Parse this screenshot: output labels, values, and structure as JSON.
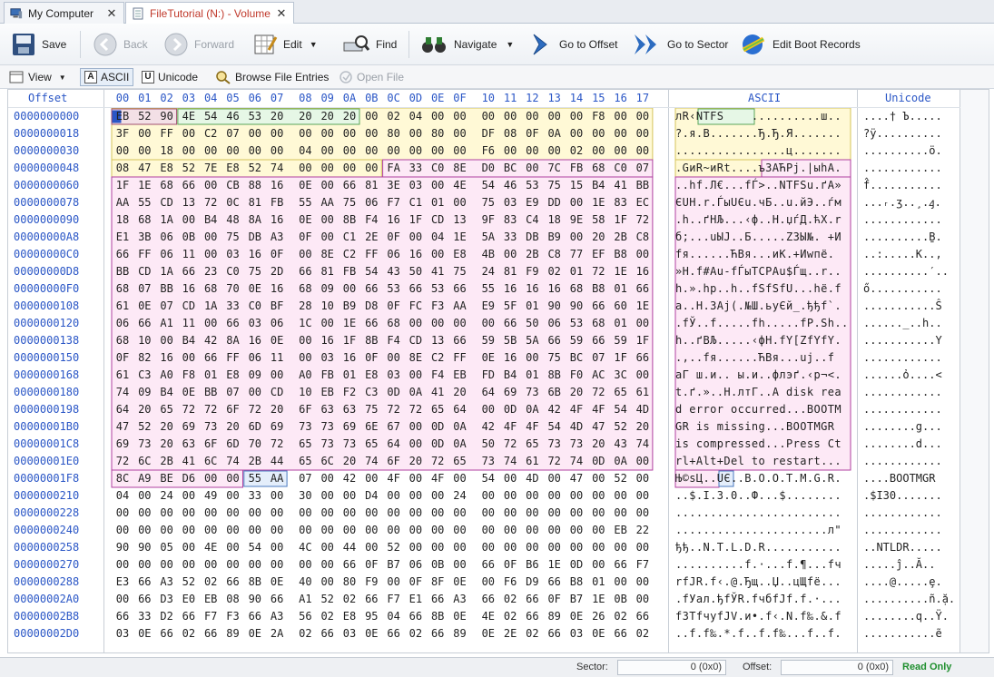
{
  "tabs": [
    {
      "label": "My Computer",
      "close": "✕",
      "icon": "computer-icon"
    },
    {
      "label": "FileTutorial (N:) - Volume",
      "close": "✕",
      "icon": "volume-icon"
    }
  ],
  "toolbar": {
    "save": "Save",
    "back": "Back",
    "forward": "Forward",
    "edit": "Edit",
    "find": "Find",
    "navigate": "Navigate",
    "goto_offset": "Go to Offset",
    "goto_sector": "Go to Sector",
    "edit_boot": "Edit Boot Records"
  },
  "toolbar2": {
    "view": "View",
    "ascii": "ASCII",
    "unicode": "Unicode",
    "browse": "Browse File Entries",
    "open": "Open File"
  },
  "headers": {
    "offset": "Offset",
    "bytes": [
      "00",
      "01",
      "02",
      "03",
      "04",
      "05",
      "06",
      "07",
      "08",
      "09",
      "0A",
      "0B",
      "0C",
      "0D",
      "0E",
      "0F",
      "10",
      "11",
      "12",
      "13",
      "14",
      "15",
      "16",
      "17"
    ],
    "ascii": "ASCII",
    "unicode": "Unicode"
  },
  "rows": [
    {
      "off": "0000000000",
      "hex": "EB 52 90 4E 54 46 53 20 20 20 20 00 02 04 00 00 00 00 00 00 00 F8 00 00",
      "asc": "лR‹NTFS    ..........ш..",
      "uni": "....† Ъ....."
    },
    {
      "off": "0000000018",
      "hex": "3F 00 FF 00 C2 07 00 00 00 00 00 00 80 00 80 00 DF 08 0F 0A 00 00 00 00",
      "asc": "?.я.В.......Ђ.Ђ.Я.......",
      "uni": "?ÿ.........."
    },
    {
      "off": "0000000030",
      "hex": "00 00 18 00 00 00 00 00 04 00 00 00 00 00 00 00 F6 00 00 00 02 00 00 00",
      "asc": "................ц.......",
      "uni": "..........ö."
    },
    {
      "off": "0000000048",
      "hex": "08 47 E8 52 7E E8 52 74 00 00 00 00 FA 33 C0 8E D0 BC 00 7C FB 68 C0 07",
      "asc": ".GиR~иRt....ъ3АЋРј.|ыhА.",
      "uni": "............"
    },
    {
      "off": "0000000060",
      "hex": "1F 1E 68 66 00 CB 88 16 0E 00 66 81 3E 03 00 4E 54 46 53 75 15 B4 41 BB",
      "asc": "..hf.Л€...fЃ>..NTFSu.ґA»",
      "uni": "f̂..........."
    },
    {
      "off": "0000000078",
      "hex": "AA 55 CD 13 72 0C 81 FB 55 AA 75 06 F7 C1 01 00 75 03 E9 DD 00 1E 83 EC",
      "asc": "ЄUН.r.ЃыUЄu.чБ..u.йЭ..ѓм",
      "uni": "...ᵣ.ʒ..¸.ꜭ."
    },
    {
      "off": "0000000090",
      "hex": "18 68 1A 00 B4 48 8A 16 0E 00 8B F4 16 1F CD 13 9F 83 C4 18 9E 58 1F 72",
      "asc": ".h..ґHЉ...‹ф..Н.џѓД.ћX.r",
      "uni": "............"
    },
    {
      "off": "00000000A8",
      "hex": "E1 3B 06 0B 00 75 DB A3 0F 00 C1 2E 0F 00 04 1E 5A 33 DB B9 00 20 2B C8",
      "asc": "б;...uЫЈ..Б.....Z3Ы№. +И",
      "uni": "..........Ḇ."
    },
    {
      "off": "00000000C0",
      "hex": "66 FF 06 11 00 03 16 0F 00 8E C2 FF 06 16 00 E8 4B 00 2B C8 77 EF B8 00",
      "asc": "fя......ЋВя...иK.+Иwпё.",
      "uni": "..:.....K..,"
    },
    {
      "off": "00000000D8",
      "hex": "BB CD 1A 66 23 C0 75 2D 66 81 FB 54 43 50 41 75 24 81 F9 02 01 72 1E 16",
      "asc": "»Н.f#Аu-fЃыTCPAu$Ѓщ..r..",
      "uni": "..........′.."
    },
    {
      "off": "00000000F0",
      "hex": "68 07 BB 16 68 70 0E 16 68 09 00 66 53 66 53 66 55 16 16 16 68 B8 01 66",
      "asc": "h.».hp..h..fSfSfU...hё.f",
      "uni": "ő..........."
    },
    {
      "off": "0000000108",
      "hex": "61 0E 07 CD 1A 33 C0 BF 28 10 B9 D8 0F FC F3 AA E9 5F 01 90 90 66 60 1E",
      "asc": "a..Н.3Ај(.№Ш.ьуЄй_.ђђf`.",
      "uni": "...........Ŝ"
    },
    {
      "off": "0000000120",
      "hex": "06 66 A1 11 00 66 03 06 1C 00 1E 66 68 00 00 00 00 66 50 06 53 68 01 00",
      "asc": ".fЎ..f.....fh.....fP.Sh..",
      "uni": "......_..h.."
    },
    {
      "off": "0000000138",
      "hex": "68 10 00 B4 42 8A 16 0E 00 16 1F 8B F4 CD 13 66 59 5B 5A 66 59 66 59 1F",
      "asc": "h..ґBЉ.....‹фН.fY[ZfYfY.",
      "uni": "...........Y"
    },
    {
      "off": "0000000150",
      "hex": "0F 82 16 00 66 FF 06 11 00 03 16 0F 00 8E C2 FF 0E 16 00 75 BC 07 1F 66",
      "asc": ".‚..fя......ЋВя...uј..f",
      "uni": "............"
    },
    {
      "off": "0000000168",
      "hex": "61 C3 A0 F8 01 E8 09 00 A0 FB 01 E8 03 00 F4 EB FD B4 01 8B F0 AC 3C 00",
      "asc": "aГ ш.и.. ы.и..флэґ.‹р¬<.",
      "uni": "......ὀ....<"
    },
    {
      "off": "0000000180",
      "hex": "74 09 B4 0E BB 07 00 CD 10 EB F2 C3 0D 0A 41 20 64 69 73 6B 20 72 65 61",
      "asc": "t.ґ.»..Н.лтГ..A disk rea",
      "uni": "............"
    },
    {
      "off": "0000000198",
      "hex": "64 20 65 72 72 6F 72 20 6F 63 63 75 72 72 65 64 00 0D 0A 42 4F 4F 54 4D",
      "asc": "d error occurred...BOOTM",
      "uni": "............"
    },
    {
      "off": "00000001B0",
      "hex": "47 52 20 69 73 20 6D 69 73 73 69 6E 67 00 0D 0A 42 4F 4F 54 4D 47 52 20",
      "asc": "GR is missing...BOOTMGR ",
      "uni": "........g..."
    },
    {
      "off": "00000001C8",
      "hex": "69 73 20 63 6F 6D 70 72 65 73 73 65 64 00 0D 0A 50 72 65 73 73 20 43 74",
      "asc": "is compressed...Press Ct",
      "uni": "........d..."
    },
    {
      "off": "00000001E0",
      "hex": "72 6C 2B 41 6C 74 2B 44 65 6C 20 74 6F 20 72 65 73 74 61 72 74 0D 0A 00",
      "asc": "rl+Alt+Del to restart...",
      "uni": "............"
    },
    {
      "off": "00000001F8",
      "hex": "8C A9 BE D6 00 00 55 AA 07 00 42 00 4F 00 4F 00 54 00 4D 00 47 00 52 00",
      "asc": "Њ©ѕЦ..UЄ..B.O.O.T.M.G.R.",
      "uni": "....BOOTMGR"
    },
    {
      "off": "0000000210",
      "hex": "04 00 24 00 49 00 33 00 30 00 00 D4 00 00 00 24 00 00 00 00 00 00 00 00",
      "asc": "..$.I.3.0..Ф...$........",
      "uni": ".$I30......."
    },
    {
      "off": "0000000228",
      "hex": "00 00 00 00 00 00 00 00 00 00 00 00 00 00 00 00 00 00 00 00 00 00 00 00",
      "asc": "........................",
      "uni": "............"
    },
    {
      "off": "0000000240",
      "hex": "00 00 00 00 00 00 00 00 00 00 00 00 00 00 00 00 00 00 00 00 00 00 EB 22",
      "asc": "......................л\"",
      "uni": "............"
    },
    {
      "off": "0000000258",
      "hex": "90 90 05 00 4E 00 54 00 4C 00 44 00 52 00 00 00 00 00 00 00 00 00 00 00",
      "asc": "ђђ..N.T.L.D.R...........",
      "uni": "..NTLDR....."
    },
    {
      "off": "0000000270",
      "hex": "00 00 00 00 00 00 00 00 00 00 66 0F B7 06 0B 00 66 0F B6 1E 0D 00 66 F7",
      "asc": "..........f.·...f.¶...fч",
      "uni": ".....ĵ..Ă.."
    },
    {
      "off": "0000000288",
      "hex": "E3 66 A3 52 02 66 8B 0E 40 00 80 F9 00 0F 8F 0E 00 F6 D9 66 B8 01 00 00",
      "asc": "rfЈR.f‹.@.Ђщ..Џ..цЩfё...",
      "uni": "....@.....ȩ."
    },
    {
      "off": "00000002A0",
      "hex": "00 66 D3 E0 EB 08 90 66 A1 52 02 66 F7 E1 66 A3 66 02 66 0F B7 1E 0B 00",
      "asc": ".fУал.ђfЎR.fчбfЈf.f.·...",
      "uni": "..........ñ.ặ."
    },
    {
      "off": "00000002B8",
      "hex": "66 33 D2 66 F7 F3 66 A3 56 02 E8 95 04 66 8B 0E 4E 02 66 89 0E 26 02 66",
      "asc": "f3ТfчуfЈV.и•.f‹.N.f‰.&.f",
      "uni": "........q..Ÿ."
    },
    {
      "off": "00000002D0",
      "hex": "03 0E 66 02 66 89 0E 2A 02 66 03 0E 66 02 66 89 0E 2E 02 66 03 0E 66 02",
      "asc": "..f.f‰.*.f..f.f‰...f..f.",
      "uni": "...........ẽ"
    }
  ],
  "status": {
    "sector_label": "Sector:",
    "sector_value": "0 (0x0)",
    "offset_label": "Offset:",
    "offset_value": "0 (0x0)",
    "mode": "Read Only"
  },
  "colors": {
    "offset_blue": "#2a56c6",
    "region_yellow": "#fff9d6",
    "region_pink": "#fde9f6",
    "region_green": "#e6f7e6",
    "region_blue": "#e4eefb",
    "tab_active": "#c0392b",
    "readonly_green": "#1f8f2e"
  }
}
